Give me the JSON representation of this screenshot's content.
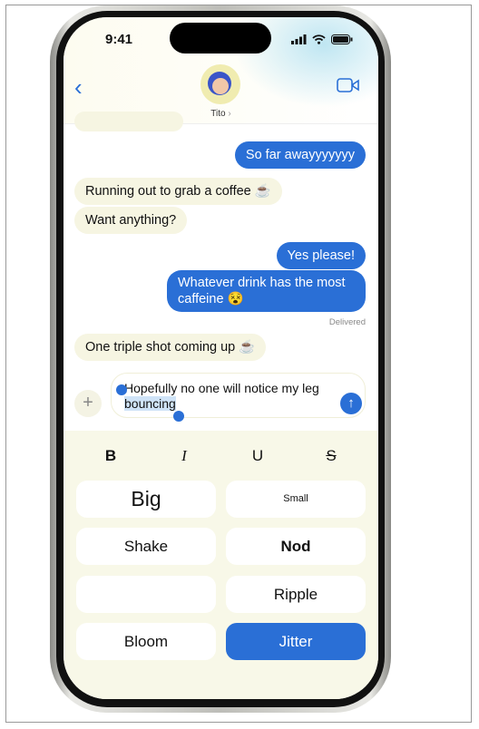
{
  "status": {
    "time": "9:41"
  },
  "header": {
    "contact": "Tito",
    "chevron": "›"
  },
  "messages": [
    {
      "dir": "out",
      "text": "So far awayyyyyyy"
    },
    {
      "dir": "in",
      "text": "Running out to grab a coffee ☕"
    },
    {
      "dir": "in",
      "text": "Want anything?"
    },
    {
      "dir": "out",
      "text": "Yes please!"
    },
    {
      "dir": "out",
      "text": "Whatever drink has the most caffeine 😵"
    },
    {
      "dir": "in",
      "text": "One triple shot coming up ☕"
    }
  ],
  "delivered": "Delivered",
  "composer": {
    "text_before": "Hopefully no one will notice my leg ",
    "text_selected": "bouncing"
  },
  "format": {
    "bold": "B",
    "italic": "I",
    "underline": "U",
    "strike": "S"
  },
  "effects": [
    "Big",
    "Small",
    "Shake",
    "Nod",
    "",
    "Ripple",
    "Bloom",
    "Jitter"
  ],
  "selected_effect": "Jitter",
  "colors": {
    "accent": "#2a6fd6",
    "incoming": "#f6f5e2"
  }
}
